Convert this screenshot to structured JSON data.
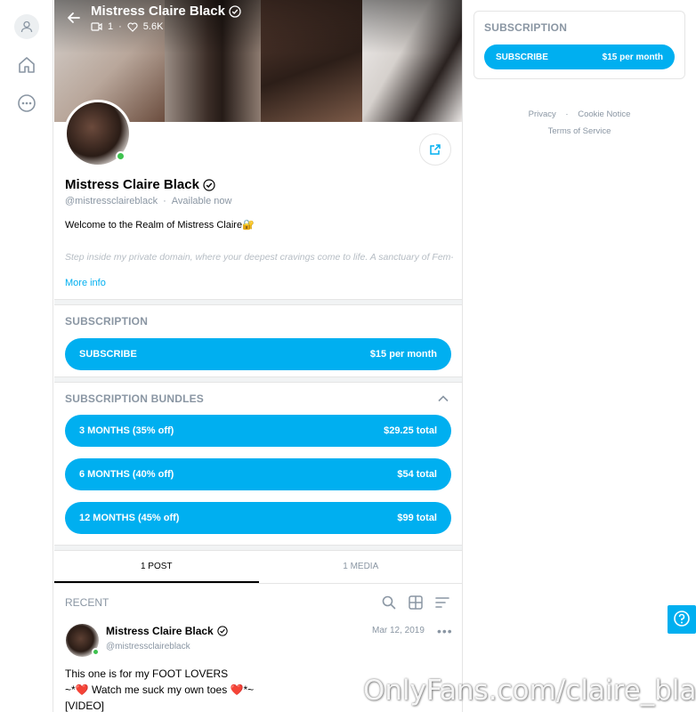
{
  "cover": {
    "title": "Mistress Claire Black",
    "posts_count": "1",
    "likes_count": "5.6K"
  },
  "profile": {
    "name": "Mistress Claire Black",
    "handle": "@mistressclaireblack",
    "status": "Available now",
    "bio_line1": "Welcome to the Realm of Mistress Claire🔐",
    "bio_line2": "Step inside my private domain, where your deepest cravings come to life. A sanctuary of Fem-",
    "more_info": "More info"
  },
  "subscription": {
    "title": "SUBSCRIPTION",
    "subscribe_label": "SUBSCRIBE",
    "price": "$15 per month"
  },
  "bundles": {
    "title": "SUBSCRIPTION BUNDLES",
    "items": [
      {
        "label": "3 MONTHS (35% off)",
        "price": "$29.25 total"
      },
      {
        "label": "6 MONTHS (40% off)",
        "price": "$54 total"
      },
      {
        "label": "12 MONTHS (45% off)",
        "price": "$99 total"
      }
    ]
  },
  "tabs": [
    {
      "label": "1 POST"
    },
    {
      "label": "1 MEDIA"
    }
  ],
  "feed": {
    "recent_label": "RECENT",
    "post": {
      "name": "Mistress Claire Black",
      "handle": "@mistressclaireblack",
      "date": "Mar 12, 2019",
      "line1": "This one is for my FOOT LOVERS",
      "line2": "~*❤️ Watch me suck my own toes ❤️*~",
      "line3": "[VIDEO]"
    }
  },
  "sidebar_right": {
    "title": "SUBSCRIPTION",
    "subscribe_label": "SUBSCRIBE",
    "price": "$15 per month",
    "links": {
      "privacy": "Privacy",
      "cookie": "Cookie Notice",
      "terms": "Terms of Service"
    }
  },
  "watermark": "OnlyFans.com/claire_black",
  "colors": {
    "accent": "#00aff0",
    "online": "#3ec24f",
    "muted": "#8a96a3"
  }
}
